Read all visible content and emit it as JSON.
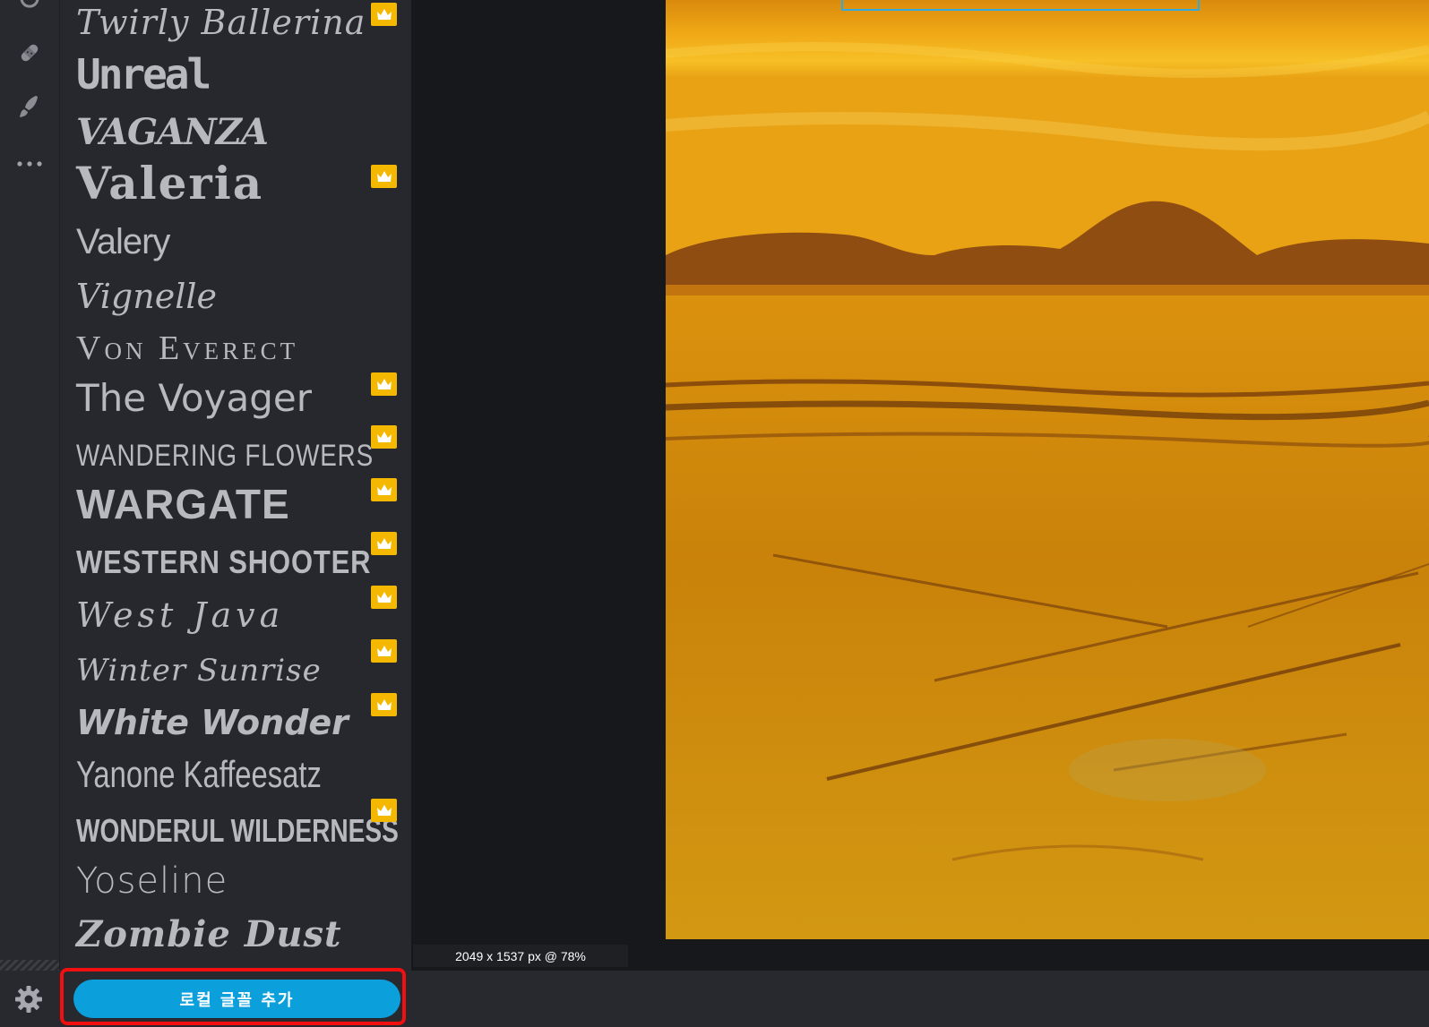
{
  "rail": {
    "tools": [
      {
        "icon": "heal-bandage-icon"
      },
      {
        "icon": "brush-icon"
      },
      {
        "icon": "more-icon"
      }
    ]
  },
  "font_list": [
    {
      "name": "Twirly Ballerina",
      "premium": true
    },
    {
      "name": "Unreal",
      "premium": false
    },
    {
      "name": "VAGANZA",
      "premium": false
    },
    {
      "name": "Valeria",
      "premium": true
    },
    {
      "name": "Valery",
      "premium": false
    },
    {
      "name": "Vignelle",
      "premium": false
    },
    {
      "name": "Von Everect",
      "premium": false
    },
    {
      "name": "The Voyager",
      "premium": true
    },
    {
      "name": "WANDERING FLOWERS",
      "premium": true
    },
    {
      "name": "WARGATE",
      "premium": true
    },
    {
      "name": "WESTERN SHOOTER",
      "premium": true
    },
    {
      "name": "West Java",
      "premium": true
    },
    {
      "name": "Winter Sunrise",
      "premium": true
    },
    {
      "name": "White Wonder",
      "premium": true
    },
    {
      "name": "Yanone Kaffeesatz",
      "premium": false
    },
    {
      "name": "WONDERUL WILDERNESS",
      "premium": true
    },
    {
      "name": "Yoseline",
      "premium": false
    },
    {
      "name": "Zombie Dust",
      "premium": false
    }
  ],
  "bottom": {
    "add_local_font_label": "로컬 글꼴 추가",
    "settings_icon": "gear-icon"
  },
  "canvas": {
    "status_text": "2049 x 1537 px @ 78%"
  },
  "colors": {
    "accent": "#0b9fdc",
    "premium_badge": "#f5b800",
    "highlight": "#f20f0f"
  }
}
